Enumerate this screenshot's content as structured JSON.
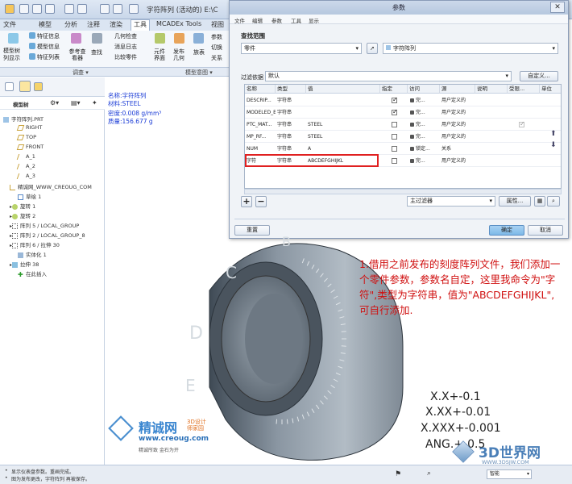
{
  "window": {
    "title": "字符阵列 (活动的) E:\\C",
    "controls": [
      "—",
      "□",
      "✕"
    ]
  },
  "ribbon": {
    "tabs": [
      "文件",
      "模型",
      "分析",
      "注释",
      "渲染",
      "工具",
      "MCADEx Tools",
      "视图"
    ],
    "active_tab": "工具",
    "items": {
      "tree_col": "模型树",
      "tree_col2": "列显示",
      "feature_info": "特征信息",
      "model_info": "模型信息",
      "feature_list": "特征列表",
      "ref_viewer": "参考查看器",
      "find": "查找",
      "geom_check": "几何检查",
      "msg_log": "消息日志",
      "compare_part": "比较零件",
      "component_ui": "元件界面",
      "publish_geom": "发布几何",
      "family_table": "族表",
      "params": "参数",
      "switch": "切换",
      "relations": "关系"
    },
    "groups": [
      "调查 ▾",
      "模型意图 ▾"
    ]
  },
  "model_tree": {
    "header": "模型树",
    "items": [
      "字符阵列.PRT",
      "RIGHT",
      "TOP",
      "FRONT",
      "A_1",
      "A_2",
      "A_3",
      "精诚网_WWW_CREOUG_COM",
      "草绘 1",
      "旋转 1",
      "旋转 2",
      "阵列 5 / LOCAL_GROUP",
      "阵列 2 / LOCAL_GROUP_8",
      "阵列 6 / 拉伸 30",
      "实体化 1",
      "拉伸 38",
      "在此插入"
    ]
  },
  "info": {
    "name": "名称:字符阵列",
    "material": "材料:STEEL",
    "density": "密度:0.008 g/mm³",
    "mass": "质量:156.677 g"
  },
  "dialog": {
    "title": "参数",
    "menu": [
      "文件",
      "编辑",
      "参数",
      "工具",
      "显示"
    ],
    "search_scope_label": "查找范围",
    "scope_type": "零件",
    "scope_object": "字符阵列",
    "filter_label": "过滤依据",
    "filter_value": "默认",
    "custom_btn": "自定义...",
    "columns": [
      "名称",
      "类型",
      "值",
      "指定",
      "访问",
      "源",
      "说明",
      "受限...",
      "单位"
    ],
    "rows": [
      {
        "name": "DESCRIP...",
        "type": "字符串",
        "value": "",
        "designate": true,
        "access": "完...",
        "source": "用户定义的",
        "desc": "",
        "restricted": false
      },
      {
        "name": "MODELED_BY",
        "type": "字符串",
        "value": "",
        "designate": true,
        "access": "完...",
        "source": "用户定义的",
        "desc": "",
        "restricted": false
      },
      {
        "name": "PTC_MAT...",
        "type": "字符串",
        "value": "STEEL",
        "designate": false,
        "access": "完...",
        "source": "用户定义的",
        "desc": "",
        "restricted": true
      },
      {
        "name": "MP_RF...",
        "type": "字符串",
        "value": "STEEL",
        "designate": false,
        "access": "完...",
        "source": "用户定义的",
        "desc": "",
        "restricted": false
      },
      {
        "name": "NUM",
        "type": "字符串",
        "value": "A",
        "designate": false,
        "access": "锁定...",
        "source": "关系",
        "desc": "",
        "restricted": false
      },
      {
        "name": "字符",
        "type": "字符串",
        "value": "ABCDEFGHIJKL",
        "designate": false,
        "access": "完...",
        "source": "用户定义的",
        "desc": "",
        "restricted": false
      }
    ],
    "highlighted_row": 5,
    "main_filter": "主过滤器",
    "properties_btn": "属性...",
    "reset_btn": "重置",
    "ok_btn": "确定",
    "cancel_btn": "取消"
  },
  "annotation": {
    "text": "1.借用之前发布的刻度阵列文件，我们添加一个零件参数，参数名自定，这里我命令为\"字符\",类型为字符串，值为\"ABCDEFGHIJKL\",可自行添加."
  },
  "tolerances": [
    "X.X+-0.1",
    "X.XX+-0.01",
    "X.XXX+-0.001",
    "ANG.+-0.5"
  ],
  "watermark": {
    "brand": "精诚网",
    "url": "www.creoug.com",
    "sub": "3D设计 师家园",
    "slogan": "精诚所致 金石为开"
  },
  "logo_3d": {
    "name": "3D世界网",
    "url": "WWW.3DSJW.COM"
  },
  "status": {
    "line1": "显示仪表盘参数。重画完成。",
    "line2": "图为发布更改，字符阵列 再被保存。",
    "mode": "智能"
  },
  "colors": {
    "accent": "#7db9e8",
    "annotation_red": "#d01010",
    "highlight_box": "#e02020",
    "info_blue": "#1a3bd6"
  }
}
